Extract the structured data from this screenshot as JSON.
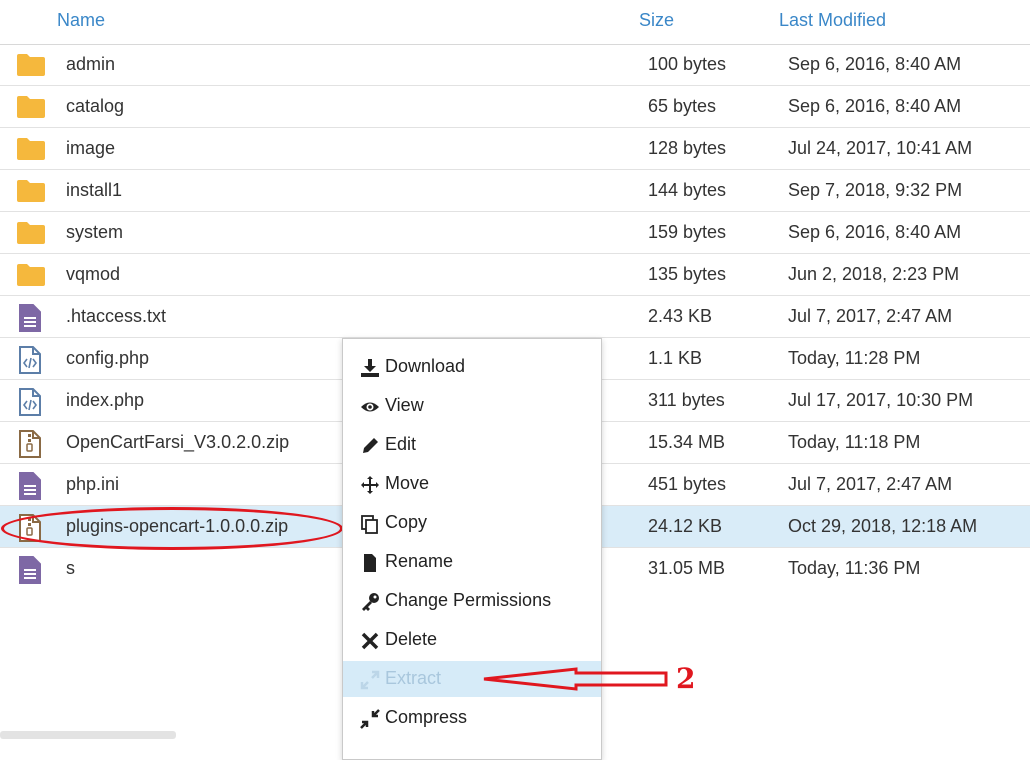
{
  "header": {
    "name": "Name",
    "size": "Size",
    "modified": "Last Modified"
  },
  "files": [
    {
      "name": "admin",
      "size": "100 bytes",
      "modified": "Sep 6, 2016, 8:40 AM",
      "icon": "folder-icon",
      "type": "folder"
    },
    {
      "name": "catalog",
      "size": "65 bytes",
      "modified": "Sep 6, 2016, 8:40 AM",
      "icon": "folder-icon",
      "type": "folder"
    },
    {
      "name": "image",
      "size": "128 bytes",
      "modified": "Jul 24, 2017, 10:41 AM",
      "icon": "folder-icon",
      "type": "folder"
    },
    {
      "name": "install1",
      "size": "144 bytes",
      "modified": "Sep 7, 2018, 9:32 PM",
      "icon": "folder-icon",
      "type": "folder"
    },
    {
      "name": "system",
      "size": "159 bytes",
      "modified": "Sep 6, 2016, 8:40 AM",
      "icon": "folder-icon",
      "type": "folder"
    },
    {
      "name": "vqmod",
      "size": "135 bytes",
      "modified": "Jun 2, 2018, 2:23 PM",
      "icon": "folder-icon",
      "type": "folder"
    },
    {
      "name": ".htaccess.txt",
      "size": "2.43 KB",
      "modified": "Jul 7, 2017, 2:47 AM",
      "icon": "text-file-icon",
      "type": "text"
    },
    {
      "name": "config.php",
      "size": "1.1 KB",
      "modified": "Today, 11:28 PM",
      "icon": "code-file-icon",
      "type": "code"
    },
    {
      "name": "index.php",
      "size": "311 bytes",
      "modified": "Jul 17, 2017, 10:30 PM",
      "icon": "code-file-icon",
      "type": "code"
    },
    {
      "name": "OpenCartFarsi_V3.0.2.0.zip",
      "size": "15.34 MB",
      "modified": "Today, 11:18 PM",
      "icon": "zip-file-icon",
      "type": "zip"
    },
    {
      "name": "php.ini",
      "size": "451 bytes",
      "modified": "Jul 7, 2017, 2:47 AM",
      "icon": "text-file-icon",
      "type": "text"
    },
    {
      "name": "plugins-opencart-1.0.0.0.zip",
      "size": "24.12 KB",
      "modified": "Oct 29, 2018, 12:18 AM",
      "icon": "zip-file-icon",
      "type": "zip",
      "selected": true
    },
    {
      "name": "s",
      "size": "31.05 MB",
      "modified": "Today, 11:36 PM",
      "icon": "text-file-icon",
      "type": "text"
    }
  ],
  "context_menu": [
    {
      "label": "Download",
      "icon": "download-icon"
    },
    {
      "label": "View",
      "icon": "eye-icon"
    },
    {
      "label": "Edit",
      "icon": "pencil-icon"
    },
    {
      "label": "Move",
      "icon": "move-arrows-icon"
    },
    {
      "label": "Copy",
      "icon": "copy-icon"
    },
    {
      "label": "Rename",
      "icon": "file-icon"
    },
    {
      "label": "Change Permissions",
      "icon": "key-icon"
    },
    {
      "label": "Delete",
      "icon": "x-icon"
    },
    {
      "label": "Extract",
      "icon": "expand-icon",
      "disabled": true
    },
    {
      "label": "Compress",
      "icon": "compress-icon"
    }
  ],
  "annotation": {
    "number": "2"
  },
  "colors": {
    "header_text": "#3a87c8",
    "folder": "#f5b83d",
    "text_file": "#7e68a5",
    "code_file": "#5c7ea8",
    "zip_file": "#8a6a45",
    "selected_row": "#d9ecf8",
    "annotation": "#e0171f",
    "disabled_item": "#d6ebf8"
  }
}
